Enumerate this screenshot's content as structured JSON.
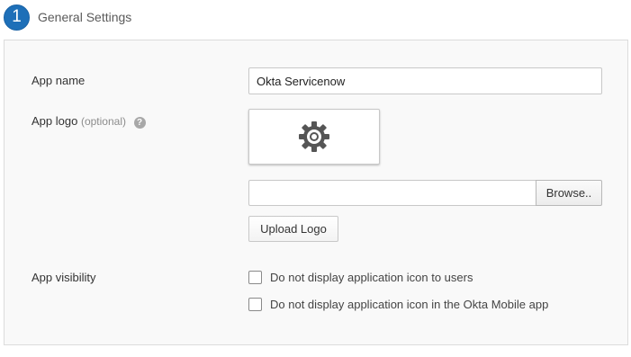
{
  "section": {
    "step_number": "1",
    "title": "General Settings"
  },
  "form": {
    "app_name": {
      "label": "App name",
      "value": "Okta Servicenow"
    },
    "app_logo": {
      "label": "App logo",
      "optional_label": "(optional)",
      "help_icon_glyph": "?",
      "placeholder_icon": "gear-icon",
      "browse_label": "Browse..",
      "upload_label": "Upload Logo"
    },
    "app_visibility": {
      "label": "App visibility",
      "options": [
        {
          "label": "Do not display application icon to users",
          "checked": false
        },
        {
          "label": "Do not display application icon in the Okta Mobile app",
          "checked": false
        }
      ]
    }
  },
  "colors": {
    "step_badge": "#1d6fb8",
    "panel_background": "#f9f9f9",
    "gear_icon": "#555555"
  }
}
